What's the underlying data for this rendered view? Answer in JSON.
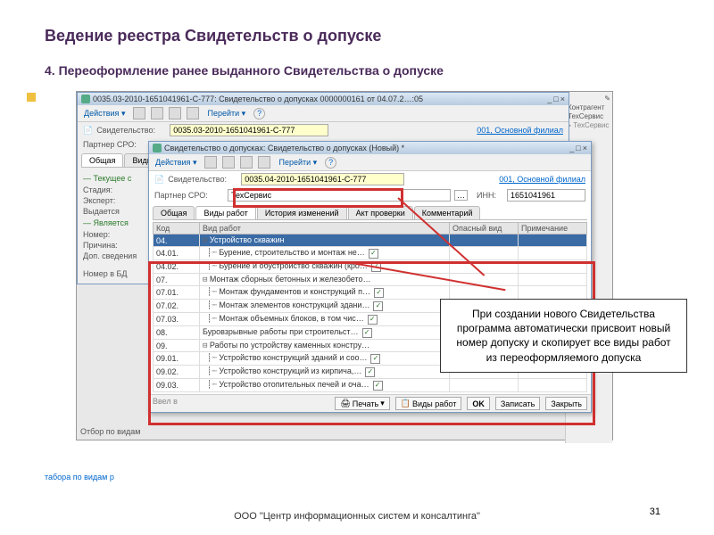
{
  "slide": {
    "title": "Ведение реестра Свидетельств о допуске",
    "subtitle": "4. Переоформление ранее выданного Свидетельства о допуске",
    "footer": "ООО \"Центр информационных систем и консалтинга\"",
    "page": "31"
  },
  "callout": "При создании нового Свидетельства программа автоматически присвоит новый номер допуску и скопирует все виды работ из переоформляемого допуска",
  "win1": {
    "title": "0035.03-2010-1651041961-С-777: Свидетельство о допусках 0000000161 от 04.07.2…:05",
    "toolbar": {
      "actions": "Действия",
      "goto": "Перейти"
    },
    "cert_label": "Свидетельство:",
    "cert_value": "0035.03-2010-1651041961-С-777",
    "branch": "001, Основной филиал",
    "partner_label": "Партнер СРО:",
    "tabs": [
      "Общая",
      "Виды"
    ],
    "group1": "Текущее с",
    "group2": "Является",
    "fields": {
      "stage": "Стадия:",
      "expert": "Эксперт:",
      "issued": "Выдается",
      "num": "Номер:",
      "reason": "Причина:",
      "extra": "Доп. сведения",
      "bdnum": "Номер в БД"
    }
  },
  "win2": {
    "title": "Свидетельство о допусках: Свидетельство о допусках (Новый) *",
    "toolbar": {
      "actions": "Действия",
      "goto": "Перейти"
    },
    "cert_label": "Свидетельство:",
    "cert_value": "0035.04-2010-1651041961-С-777",
    "branch": "001, Основной филиал",
    "partner_label": "Партнер СРО:",
    "partner_value": "ТехСервис",
    "inn_label": "ИНН:",
    "inn_value": "1651041961",
    "tabs": [
      "Общая",
      "Виды работ",
      "История изменений",
      "Акт проверки",
      "Комментарий"
    ],
    "columns": {
      "code": "Код",
      "work": "Вид работ",
      "danger": "Опасный вид",
      "note": "Примечание"
    },
    "rows": [
      {
        "code": "04.",
        "work": "Устройство скважин",
        "lvl": 0,
        "exp": "⊟"
      },
      {
        "code": "04.01.",
        "work": "Бурение, строительство и монтаж не…",
        "lvl": 1,
        "chk": true
      },
      {
        "code": "04.02.",
        "work": "Бурение и обустройство скважин (кро…",
        "lvl": 1,
        "chk": true
      },
      {
        "code": "07.",
        "work": "Монтаж сборных бетонных и железобето…",
        "lvl": 0,
        "exp": "⊟"
      },
      {
        "code": "07.01.",
        "work": "Монтаж фундаментов и конструкций п…",
        "lvl": 1,
        "chk": true
      },
      {
        "code": "07.02.",
        "work": "Монтаж элементов конструкций здани…",
        "lvl": 1,
        "chk": true
      },
      {
        "code": "07.03.",
        "work": "Монтаж объемных блоков, в том чис…",
        "lvl": 1,
        "chk": true
      },
      {
        "code": "08.",
        "work": "Буровзрывные работы при строительст…",
        "lvl": 0,
        "chk": true
      },
      {
        "code": "09.",
        "work": "Работы по устройству каменных констру…",
        "lvl": 0,
        "exp": "⊟"
      },
      {
        "code": "09.01.",
        "work": "Устройство конструкций зданий и соо…",
        "lvl": 1,
        "chk": true
      },
      {
        "code": "09.02.",
        "work": "Устройство конструкций из кирпича,…",
        "lvl": 1,
        "chk": true
      },
      {
        "code": "09.03.",
        "work": "Устройство отопительных печей и оча…",
        "lvl": 1,
        "chk": true
      }
    ],
    "status": {
      "filter": "Отбор по видам",
      "entered": "Ввел в",
      "print": "Печать",
      "works": "Виды работ",
      "ok": "OK",
      "save": "Записать",
      "close": "Закрыть"
    }
  },
  "sidepanel": {
    "counter": "Контрагент",
    "ts": "ТехСервис"
  },
  "bottomlink": "табора по видам р"
}
